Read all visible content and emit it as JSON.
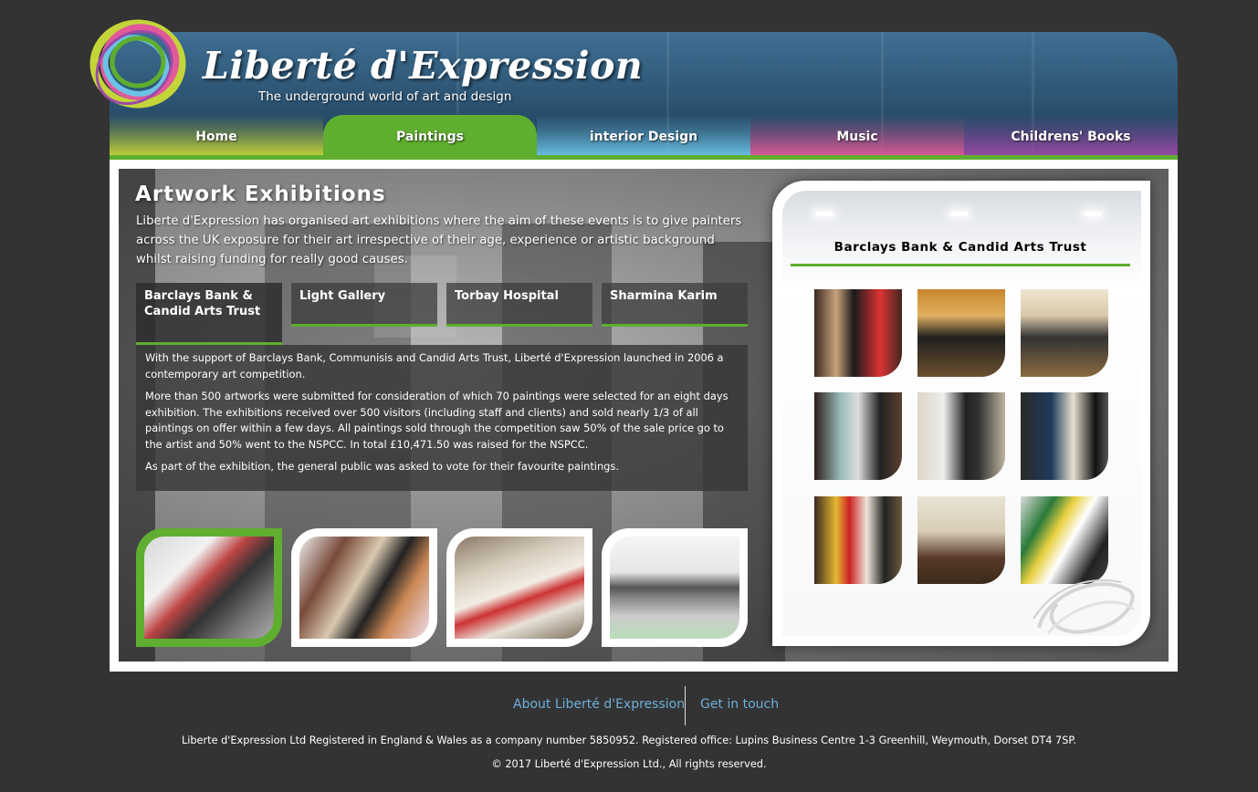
{
  "header": {
    "logo_title": "Liberté d'Expression",
    "logo_subtitle": "The underground world of art and design"
  },
  "nav": {
    "items": [
      {
        "label": "Home",
        "color": "#c4d53a",
        "active": false
      },
      {
        "label": "Paintings",
        "color": "#5fae2f",
        "active": true
      },
      {
        "label": "interior Design",
        "color": "#6cc2e6",
        "active": false
      },
      {
        "label": "Music",
        "color": "#e05a9a",
        "active": false
      },
      {
        "label": "Childrens' Books",
        "color": "#9b4aa6",
        "active": false
      }
    ]
  },
  "main": {
    "heading": "Artwork Exhibitions",
    "intro": "Liberte d'Expression has organised art exhibitions where the aim of these events is to give painters across the UK exposure for their art irrespective of their age, experience or artistic background whilst raising funding for really good causes.",
    "tabs": [
      {
        "label": "Barclays Bank & Candid Arts Trust",
        "active": true
      },
      {
        "label": "Light Gallery",
        "active": false
      },
      {
        "label": "Torbay Hospital",
        "active": false
      },
      {
        "label": "Sharmina Karim",
        "active": false
      }
    ],
    "paragraphs": [
      "With the support of Barclays Bank, Communisis and Candid Arts Trust, Liberté d'Expression launched in 2006 a contemporary art competition.",
      "More than 500 artworks were submitted for consideration of which 70 paintings were selected for an eight days exhibition. The exhibitions received over 500 visitors (including staff and clients) and sold nearly 1/3 of all paintings on offer within a few days. All paintings sold through the competition saw 50% of the sale price go to the artist and 50% went to the NSPCC. In total £10,471.50 was raised for the NSPCC.",
      "As part of the exhibition, the general public was asked to vote for their favourite paintings."
    ]
  },
  "gallery": {
    "title": "Barclays Bank & Candid Arts Trust"
  },
  "footer": {
    "about_link": "About Liberté d'Expression",
    "contact_link": "Get in touch",
    "registration": "Liberte d'Expression Ltd Registered in England & Wales as a company number 5850952. Registered office: Lupins Business Centre 1-3 Greenhill, Weymouth, Dorset DT4 7SP.",
    "copyright": "© 2017 Liberté d'Expression Ltd., All rights reserved."
  },
  "colors": {
    "accent_green": "#5fae2f",
    "background": "#333333",
    "link": "#6cb0d8"
  }
}
